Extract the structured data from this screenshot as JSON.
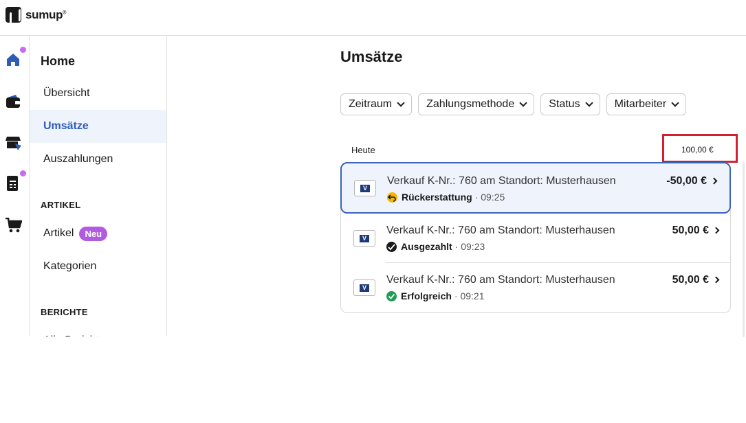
{
  "app": {
    "logo_text": "sumup"
  },
  "rail": {
    "icons": [
      "home-icon",
      "wallet-icon",
      "store-icon",
      "invoice-icon",
      "cart-icon"
    ]
  },
  "subnav": {
    "title": "Home",
    "items": [
      {
        "label": "Übersicht"
      },
      {
        "label": "Umsätze"
      },
      {
        "label": "Auszahlungen"
      }
    ],
    "section_artikel": "ARTIKEL",
    "artikel_items": [
      {
        "label": "Artikel",
        "badge": "Neu"
      },
      {
        "label": "Kategorien"
      }
    ],
    "section_berichte": "BERICHTE",
    "berichte_items": [
      {
        "label": "Alle Berichte"
      }
    ]
  },
  "main": {
    "title": "Umsätze",
    "filters": [
      {
        "label": "Zeitraum"
      },
      {
        "label": "Zahlungsmethode"
      },
      {
        "label": "Status"
      },
      {
        "label": "Mitarbeiter"
      }
    ],
    "day": {
      "label": "Heute",
      "total": "100,00 €"
    },
    "transactions": [
      {
        "title": "Verkauf K-Nr.: 760 am Standort: Musterhausen",
        "status": "Rückerstattung",
        "time": "· 09:25",
        "amount": "-50,00 €",
        "card_brand": "V PAY"
      },
      {
        "title": "Verkauf K-Nr.: 760 am Standort: Musterhausen",
        "status": "Ausgezahlt",
        "time": "· 09:23",
        "amount": "50,00 €",
        "card_brand": "V PAY"
      },
      {
        "title": "Verkauf K-Nr.: 760 am Standort: Musterhausen",
        "status": "Erfolgreich",
        "time": "· 09:21",
        "amount": "50,00 €",
        "card_brand": "V PAY"
      }
    ]
  },
  "colors": {
    "accent": "#2e5cb8",
    "badge": "#b05be0",
    "notification_dot": "#c66bf2",
    "highlight_box": "#d3202f",
    "refund": "#f5b800",
    "payout": "#1a1a1a",
    "success": "#1f9d55"
  }
}
